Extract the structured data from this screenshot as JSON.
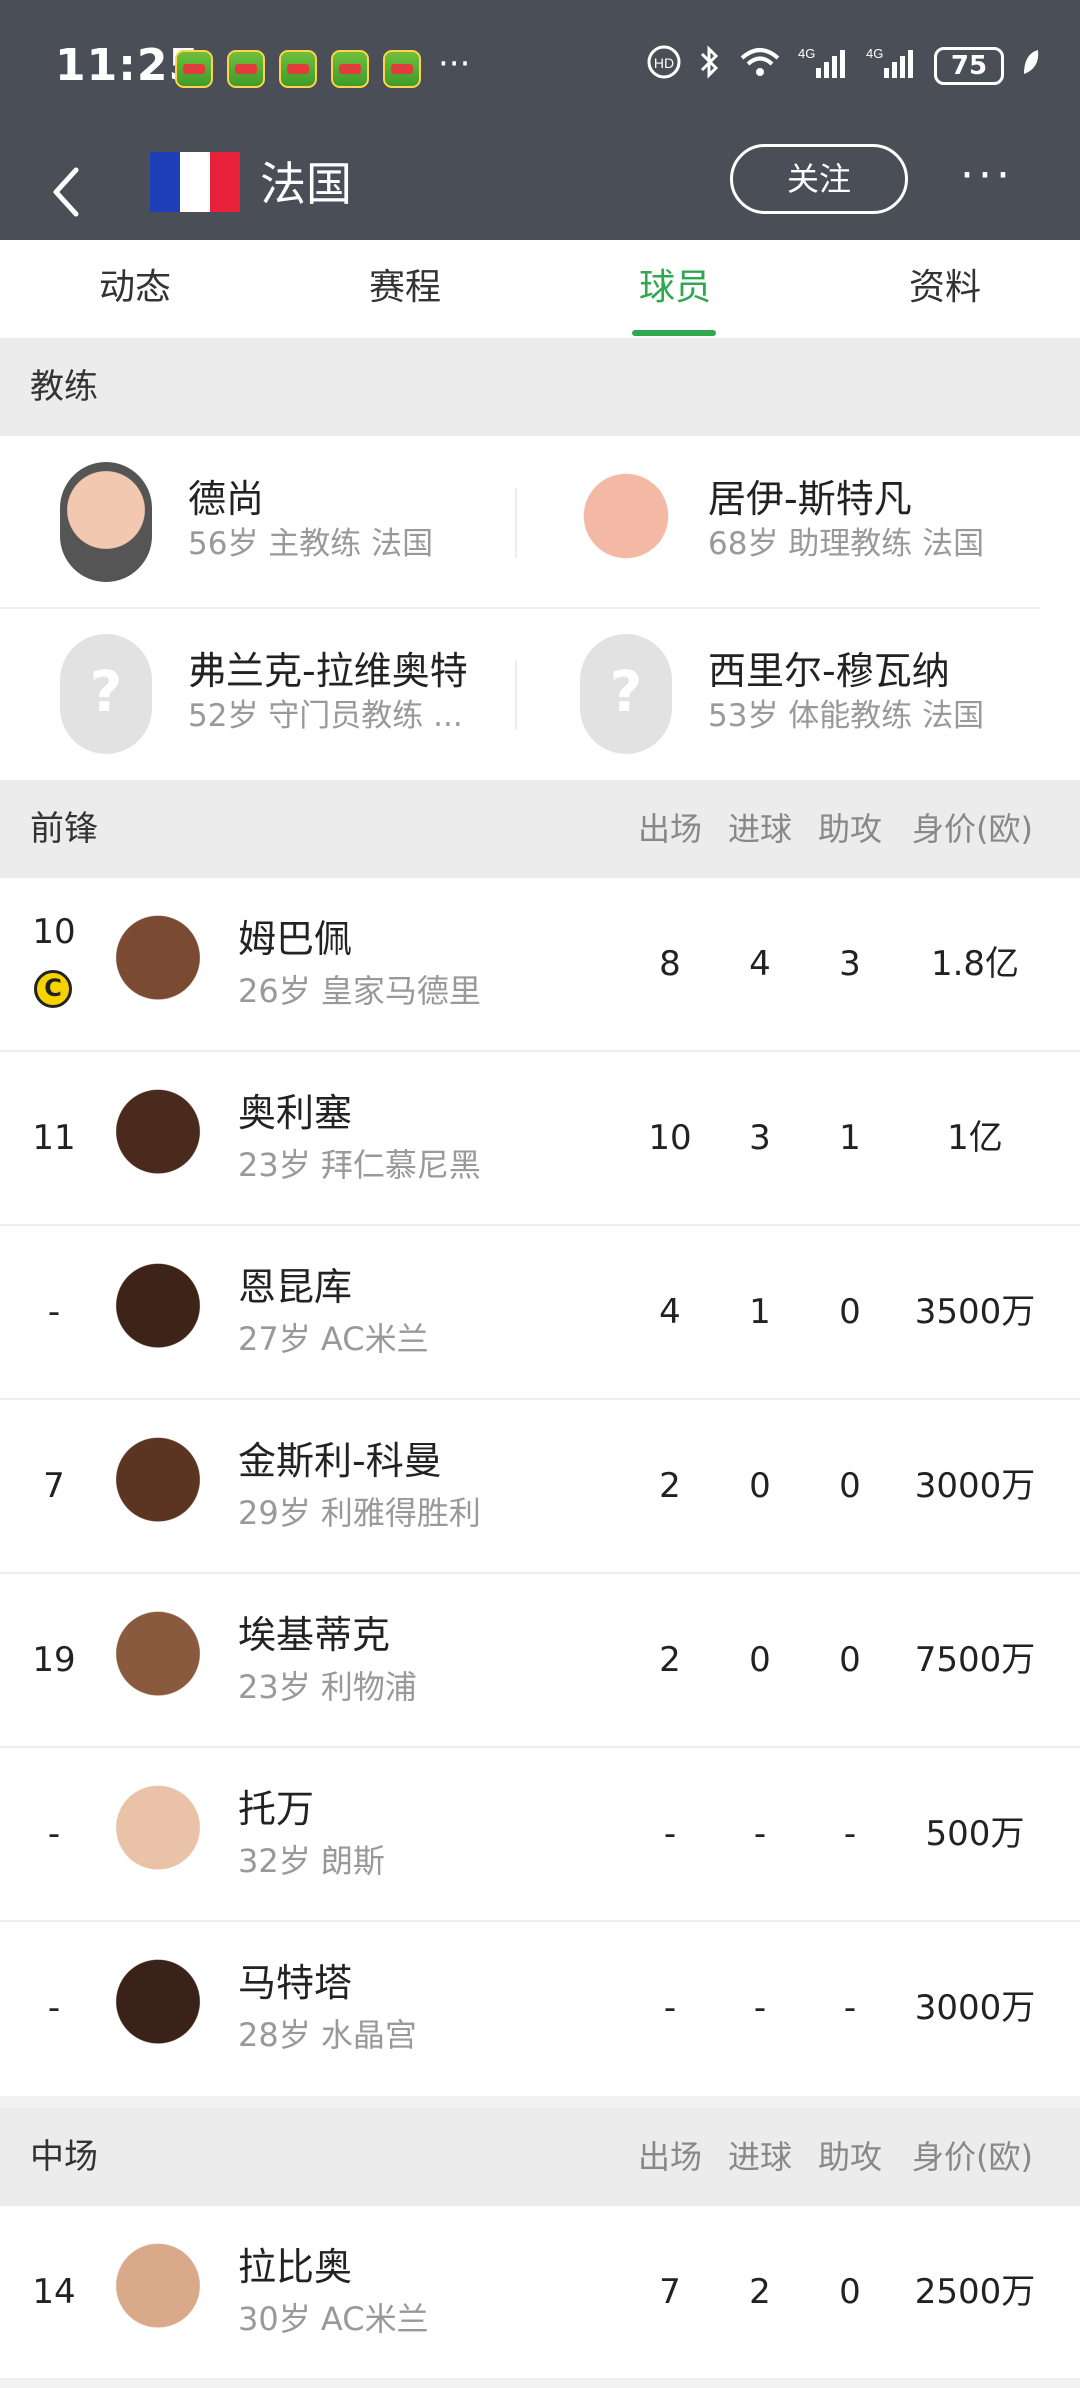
{
  "status_bar": {
    "time": "11:25",
    "more_notifications": "···",
    "battery": "75",
    "icons": [
      "hd-call-icon",
      "bluetooth-icon",
      "wifi-icon",
      "signal-4g-icon",
      "signal-4g-icon",
      "battery-icon",
      "leaf-icon"
    ]
  },
  "header": {
    "title": "法国",
    "follow_label": "关注",
    "more_label": "···",
    "flag_colors": [
      "#1f3fb8",
      "#ffffff",
      "#e8203a"
    ]
  },
  "tabs": [
    {
      "label": "动态"
    },
    {
      "label": "赛程"
    },
    {
      "label": "球员",
      "active": true
    },
    {
      "label": "资料"
    }
  ],
  "coach_section": {
    "title": "教练",
    "coaches": [
      {
        "name": "德尚",
        "detail": "56岁 主教练 法国"
      },
      {
        "name": "居伊-斯特凡",
        "detail": "68岁 助理教练 法国"
      },
      {
        "name": "弗兰克-拉维奥特",
        "detail": "52岁 守门员教练 ..."
      },
      {
        "name": "西里尔-穆瓦纳",
        "detail": "53岁 体能教练 法国"
      }
    ]
  },
  "columns": [
    "出场",
    "进球",
    "助攻",
    "身价(欧)"
  ],
  "forwards": {
    "title": "前锋",
    "players": [
      {
        "number": "10",
        "captain": "C",
        "name": "姆巴佩",
        "detail": "26岁 皇家马德里",
        "apps": "8",
        "goals": "4",
        "assists": "3",
        "value": "1.8亿"
      },
      {
        "number": "11",
        "name": "奥利塞",
        "detail": "23岁 拜仁慕尼黑",
        "apps": "10",
        "goals": "3",
        "assists": "1",
        "value": "1亿"
      },
      {
        "number": "-",
        "name": "恩昆库",
        "detail": "27岁 AC米兰",
        "apps": "4",
        "goals": "1",
        "assists": "0",
        "value": "3500万"
      },
      {
        "number": "7",
        "name": "金斯利-科曼",
        "detail": "29岁 利雅得胜利",
        "apps": "2",
        "goals": "0",
        "assists": "0",
        "value": "3000万"
      },
      {
        "number": "19",
        "name": "埃基蒂克",
        "detail": "23岁 利物浦",
        "apps": "2",
        "goals": "0",
        "assists": "0",
        "value": "7500万"
      },
      {
        "number": "-",
        "name": "托万",
        "detail": "32岁 朗斯",
        "apps": "-",
        "goals": "-",
        "assists": "-",
        "value": "500万"
      },
      {
        "number": "-",
        "name": "马特塔",
        "detail": "28岁 水晶宫",
        "apps": "-",
        "goals": "-",
        "assists": "-",
        "value": "3000万"
      }
    ]
  },
  "midfielders": {
    "title": "中场",
    "players": [
      {
        "number": "14",
        "name": "拉比奥",
        "detail": "30岁 AC米兰",
        "apps": "7",
        "goals": "2",
        "assists": "0",
        "value": "2500万"
      }
    ]
  },
  "colors": {
    "accent": "#2fa84f",
    "header_bg": "#4a4f57"
  }
}
